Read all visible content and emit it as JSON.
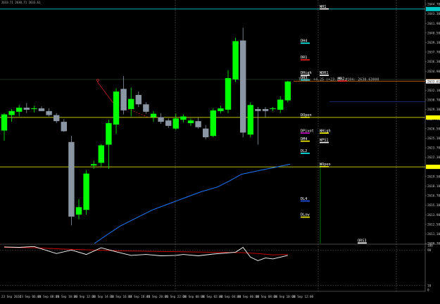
{
  "info": {
    "ohlc_text": "2633.71  2630.71  2633.61"
  },
  "trade_comment": "Tragi: +4.25 (+23.15) #104: 2638.63000",
  "colors": {
    "background": "#000000",
    "bull": "#00ff00",
    "bear": "#8a96a3",
    "ma": "#1e78ff",
    "signal": "#dd0000",
    "oscillator": "#ffffff",
    "yellow": "#ffff00",
    "teal": "#00c8c8",
    "orange": "#cc6600",
    "red": "#ff2020",
    "magenta": "#cc00cc",
    "blue": "#2255ff",
    "grid": "#7a7a7a"
  },
  "levels": [
    {
      "label": "WH1",
      "price": 2644.38,
      "color": "#00c8c8",
      "style": "solid",
      "tag_color": "#ffffff",
      "tag_col": 2
    },
    {
      "label": "DH4",
      "price": 2639.28,
      "color": "#00ffff",
      "style": "none",
      "tag_color": "#00ffff",
      "tag_col": 1
    },
    {
      "label": "DR1",
      "price": 2636.8,
      "color": "#ff2020",
      "style": "none",
      "tag_color": "#ff2020",
      "tag_col": 1
    },
    {
      "label": "DHigh",
      "price": 2634.5,
      "color": "#ffffff",
      "style": "none",
      "tag_color": "#ffffff",
      "tag_col": 1
    },
    {
      "label": "WDR1",
      "price": 2634.5,
      "color": "#ffffff",
      "style": "none",
      "tag_color": "#ffffff",
      "tag_col": 2
    },
    {
      "label": "DH3",
      "price": 2633.8,
      "color": "#00ffff",
      "style": "none",
      "tag_color": "#00ffff",
      "tag_col": 1
    },
    {
      "label": "MR2",
      "price": 2633.65,
      "color": "#cc6600",
      "style": "solid",
      "tag_color": "#ff2020",
      "tag_col": 3
    },
    {
      "label": "DOpen",
      "price": 2628.25,
      "color": "#ffff00",
      "style": "solid",
      "tag_color": "#ffff00",
      "tag_col": 1
    },
    {
      "label": "DPivot",
      "price": 2625.9,
      "color": "#cc00cc",
      "style": "none",
      "tag_color": "#cc00cc",
      "tag_col": 1
    },
    {
      "label": "WHigh",
      "price": 2625.9,
      "color": "#ffffff",
      "style": "none",
      "tag_color": "#ffff00",
      "tag_col": 2
    },
    {
      "label": "DM4",
      "price": 2624.7,
      "color": "#ffffff",
      "style": "none",
      "tag_color": "#ffff00",
      "tag_col": 1
    },
    {
      "label": "WPS1",
      "price": 2624.5,
      "color": "#ffffff",
      "style": "none",
      "tag_color": "#ffffff",
      "tag_col": 2
    },
    {
      "label": "DL2",
      "price": 2622.9,
      "color": "#00ffff",
      "style": "none",
      "tag_color": "#00ffff",
      "tag_col": 1
    },
    {
      "label": "WOpen",
      "price": 2620.9,
      "color": "#ffff00",
      "style": "solid",
      "tag_color": "#ffff00",
      "tag_col": 2
    },
    {
      "label": "DL4",
      "price": 2615.8,
      "color": "#2255ff",
      "style": "none",
      "tag_color": "#2255ff",
      "tag_col": 1
    },
    {
      "label": "DLow",
      "price": 2613.4,
      "color": "#ffff00",
      "style": "none",
      "tag_color": "#ffff00",
      "tag_col": 1
    },
    {
      "label": "ORS3",
      "price": 2609.55,
      "color": "#ffffff",
      "style": "none",
      "tag_color": "#ffffff",
      "tag_col": 4
    }
  ],
  "price_axis": {
    "ticks": [
      "2644.70",
      "2643.30",
      "2641.90",
      "2640.50",
      "2639.10",
      "2637.70",
      "2636.30",
      "2634.90",
      "2633.50",
      "2632.10",
      "2630.70",
      "2629.30",
      "2627.90",
      "2626.50",
      "2625.10",
      "2623.70",
      "2622.30",
      "2620.90",
      "2619.50",
      "2618.10",
      "2616.70",
      "2615.30",
      "2613.90",
      "2612.50",
      "2611.10",
      "2609.70"
    ],
    "current_price": "2633.61"
  },
  "osc_axis": {
    "ticks": [
      "100",
      "90",
      "10",
      "0"
    ]
  },
  "time_axis": {
    "labels": [
      "23 Sep 2024",
      "23 Sep 06:00",
      "23 Sep 08:00",
      "23 Sep 10:00",
      "23 Sep 12:00",
      "23 Sep 14:00",
      "23 Sep 16:00",
      "23 Sep 18:00",
      "23 Sep 20:00",
      "23 Sep 22:00",
      "24 Sep 00:00",
      "24 Sep 02:00",
      "24 Sep 04:00",
      "24 Sep 06:00",
      "24 Sep 08:00",
      "24 Sep 10:00",
      "24 Sep 12:00"
    ]
  },
  "chart_data": {
    "type": "candlestick",
    "y_range": [
      2609.5,
      2645.2
    ],
    "candles": [
      {
        "o": 2626.3,
        "h": 2628.9,
        "l": 2624.8,
        "c": 2628.7
      },
      {
        "o": 2628.6,
        "h": 2629.5,
        "l": 2627.6,
        "c": 2629.2
      },
      {
        "o": 2629.1,
        "h": 2630.1,
        "l": 2628.4,
        "c": 2629.7
      },
      {
        "o": 2629.7,
        "h": 2630.4,
        "l": 2628.9,
        "c": 2629.4
      },
      {
        "o": 2629.5,
        "h": 2630.0,
        "l": 2629.0,
        "c": 2629.6
      },
      {
        "o": 2629.6,
        "h": 2629.9,
        "l": 2629.2,
        "c": 2629.2
      },
      {
        "o": 2629.2,
        "h": 2629.6,
        "l": 2628.4,
        "c": 2628.6
      },
      {
        "o": 2628.6,
        "h": 2628.9,
        "l": 2627.4,
        "c": 2627.7
      },
      {
        "o": 2627.6,
        "h": 2628.0,
        "l": 2626.1,
        "c": 2626.2
      },
      {
        "o": 2624.6,
        "h": 2625.5,
        "l": 2612.2,
        "c": 2613.5
      },
      {
        "o": 2613.8,
        "h": 2616.1,
        "l": 2613.1,
        "c": 2614.9
      },
      {
        "o": 2614.5,
        "h": 2620.4,
        "l": 2613.8,
        "c": 2619.9
      },
      {
        "o": 2621.1,
        "h": 2621.8,
        "l": 2620.6,
        "c": 2621.3
      },
      {
        "o": 2621.5,
        "h": 2624.3,
        "l": 2620.9,
        "c": 2624.1
      },
      {
        "o": 2624.2,
        "h": 2627.9,
        "l": 2620.6,
        "c": 2627.4
      },
      {
        "o": 2627.2,
        "h": 2632.6,
        "l": 2625.8,
        "c": 2632.1
      },
      {
        "o": 2632.5,
        "h": 2634.4,
        "l": 2628.7,
        "c": 2629.3
      },
      {
        "o": 2629.5,
        "h": 2632.7,
        "l": 2628.4,
        "c": 2631.0
      },
      {
        "o": 2631.6,
        "h": 2632.1,
        "l": 2629.8,
        "c": 2630.2
      },
      {
        "o": 2630.2,
        "h": 2630.5,
        "l": 2628.8,
        "c": 2629.1
      },
      {
        "o": 2628.3,
        "h": 2629.2,
        "l": 2627.6,
        "c": 2628.8
      },
      {
        "o": 2628.3,
        "h": 2628.9,
        "l": 2627.3,
        "c": 2627.6
      },
      {
        "o": 2627.8,
        "h": 2628.1,
        "l": 2626.7,
        "c": 2627.0
      },
      {
        "o": 2626.6,
        "h": 2628.8,
        "l": 2626.4,
        "c": 2628.1
      },
      {
        "o": 2627.9,
        "h": 2628.7,
        "l": 2627.5,
        "c": 2628.4
      },
      {
        "o": 2627.4,
        "h": 2628.1,
        "l": 2627.0,
        "c": 2627.8
      },
      {
        "o": 2627.7,
        "h": 2628.2,
        "l": 2626.6,
        "c": 2626.8
      },
      {
        "o": 2626.6,
        "h": 2627.1,
        "l": 2625.0,
        "c": 2625.3
      },
      {
        "o": 2625.5,
        "h": 2629.6,
        "l": 2625.3,
        "c": 2629.3
      },
      {
        "o": 2629.2,
        "h": 2630.0,
        "l": 2628.9,
        "c": 2629.6
      },
      {
        "o": 2629.4,
        "h": 2635.3,
        "l": 2628.9,
        "c": 2634.1
      },
      {
        "o": 2633.9,
        "h": 2640.1,
        "l": 2633.5,
        "c": 2639.6
      },
      {
        "o": 2639.7,
        "h": 2641.6,
        "l": 2625.3,
        "c": 2626.0
      },
      {
        "o": 2625.7,
        "h": 2630.5,
        "l": 2625.3,
        "c": 2630.1
      },
      {
        "o": 2629.5,
        "h": 2629.8,
        "l": 2624.2,
        "c": 2629.2
      },
      {
        "o": 2629.5,
        "h": 2629.8,
        "l": 2628.3,
        "c": 2629.2
      },
      {
        "o": 2629.5,
        "h": 2629.8,
        "l": 2629.2,
        "c": 2629.6
      },
      {
        "o": 2629.4,
        "h": 2631.4,
        "l": 2628.9,
        "c": 2630.9
      },
      {
        "o": 2630.8,
        "h": 2633.7,
        "l": 2630.5,
        "c": 2633.6
      }
    ],
    "moving_average": [
      [
        13.6,
        2609.5
      ],
      [
        17,
        2610.9
      ],
      [
        20,
        2612.1
      ],
      [
        24,
        2613.3
      ],
      [
        28,
        2614.5
      ],
      [
        32,
        2615.4
      ],
      [
        36,
        2616.3
      ],
      [
        40,
        2617.2
      ],
      [
        44,
        2617.9
      ],
      [
        47,
        2618.8
      ],
      [
        50,
        2619.8
      ],
      [
        54,
        2620.3
      ],
      [
        58,
        2620.8
      ],
      [
        62,
        2621.3
      ]
    ],
    "oscillator": {
      "ylim": [
        0,
        100
      ],
      "main": [
        [
          0,
          97
        ],
        [
          2,
          96
        ],
        [
          4,
          98
        ],
        [
          7,
          82
        ],
        [
          9,
          90
        ],
        [
          11,
          80
        ],
        [
          13,
          95
        ],
        [
          15,
          86
        ],
        [
          17,
          78
        ],
        [
          19,
          80
        ],
        [
          21,
          77
        ],
        [
          23,
          78
        ],
        [
          24,
          80
        ],
        [
          26,
          77
        ],
        [
          28,
          81
        ],
        [
          31,
          85
        ],
        [
          32,
          96
        ],
        [
          33,
          74
        ],
        [
          34,
          66
        ],
        [
          35,
          72
        ],
        [
          36,
          70
        ],
        [
          38,
          78
        ]
      ],
      "signal": [
        [
          0,
          96
        ],
        [
          4,
          95
        ],
        [
          8,
          92
        ],
        [
          12,
          90
        ],
        [
          16,
          88
        ],
        [
          20,
          87
        ],
        [
          24,
          86
        ],
        [
          28,
          85
        ],
        [
          32,
          84
        ],
        [
          34,
          82
        ],
        [
          36,
          79
        ],
        [
          38,
          80
        ]
      ]
    }
  }
}
